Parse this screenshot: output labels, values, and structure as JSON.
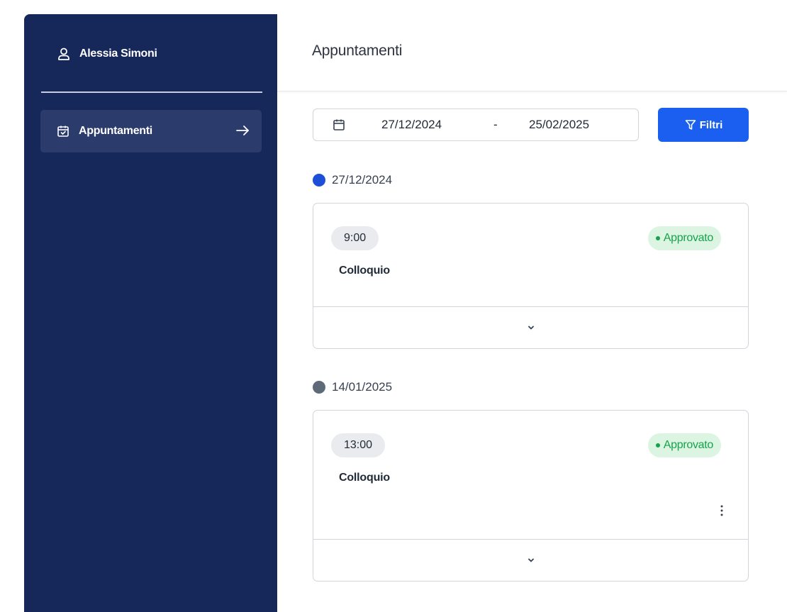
{
  "user": {
    "name": "Alessia Simoni",
    "icon": "user-icon"
  },
  "sidebar": {
    "items": [
      {
        "label": "Appuntamenti",
        "icon": "calendar-check-icon",
        "trailing_icon": "arrow-right-icon",
        "active": true
      }
    ]
  },
  "header": {
    "title": "Appuntamenti"
  },
  "filters": {
    "date_from": "27/12/2024",
    "separator": "-",
    "date_to": "25/02/2025",
    "icon": "calendar-icon",
    "button_label": "Filtri",
    "button_icon": "filter-icon"
  },
  "groups": [
    {
      "date": "27/12/2024",
      "dot_color": "#1d4ed8",
      "appointments": [
        {
          "time": "9:00",
          "status": "Approvato",
          "title": "Colloquio",
          "has_menu": false
        }
      ]
    },
    {
      "date": "14/01/2025",
      "dot_color": "#5f6a78",
      "appointments": [
        {
          "time": "13:00",
          "status": "Approvato",
          "title": "Colloquio",
          "has_menu": true
        }
      ]
    }
  ],
  "colors": {
    "sidebar_bg": "#16275a",
    "sidebar_active": "#2b3b6b",
    "primary": "#1a5ff0",
    "status_green": "#16a34a",
    "status_green_bg": "#dcf5e3"
  }
}
